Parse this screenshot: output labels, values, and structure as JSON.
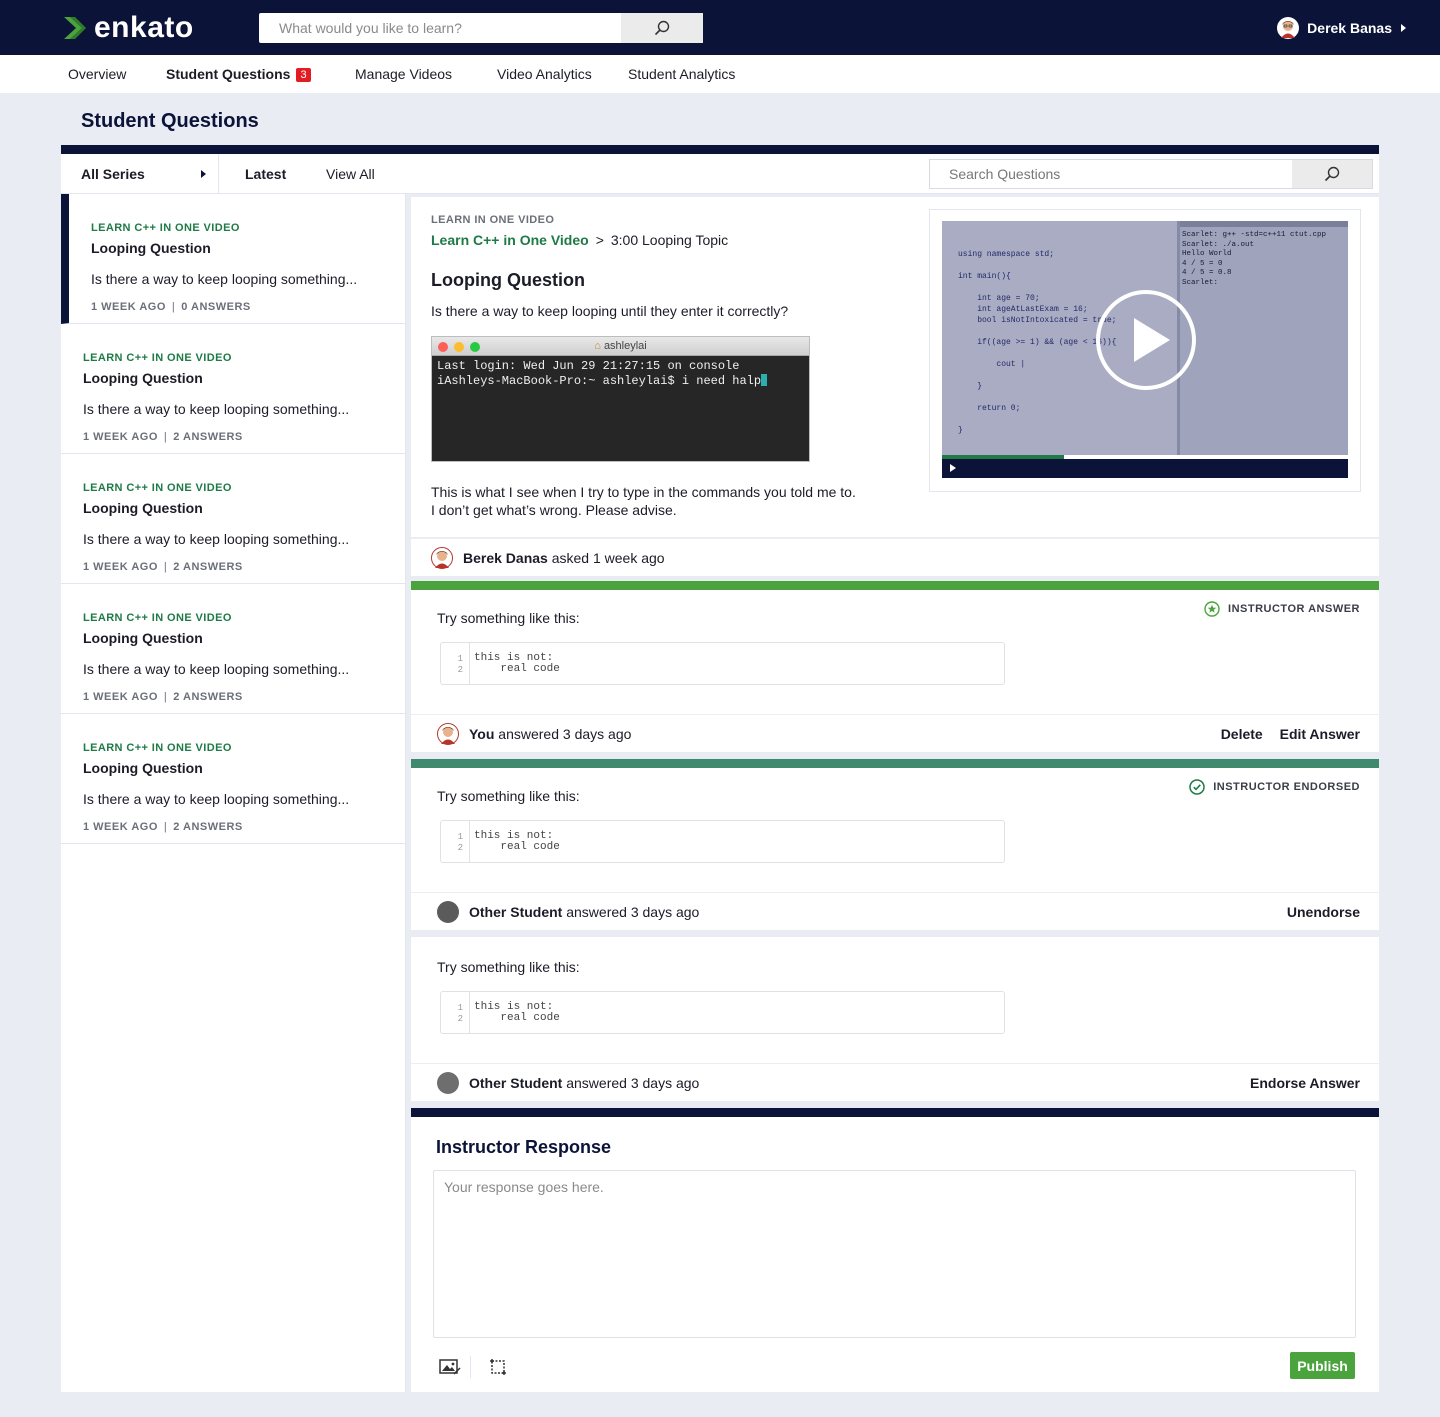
{
  "colors": {
    "navy": "#0c1338",
    "green": "#1e7a46",
    "badge_red": "#e31b23",
    "publish_green": "#4aa33c",
    "instructor_bar": "#4aa33c",
    "endorsed_bar": "#3f8a6e"
  },
  "header": {
    "brand": "enkato",
    "search_placeholder": "What would you like to learn?",
    "search_icon": "search-icon",
    "user_name": "Derek Banas"
  },
  "tabs": [
    {
      "label": "Overview"
    },
    {
      "label": "Student Questions",
      "badge": "3"
    },
    {
      "label": "Manage Videos"
    },
    {
      "label": "Video Analytics"
    },
    {
      "label": "Student Analytics"
    }
  ],
  "page": {
    "title": "Student Questions"
  },
  "filters": {
    "series": "All Series",
    "latest": "Latest",
    "view_all": "View All",
    "search_placeholder": "Search Questions"
  },
  "questions": [
    {
      "series": "LEARN C++ IN ONE VIDEO",
      "title": "Looping Question",
      "snippet": "Is there a way to keep looping something...",
      "age": "1 WEEK AGO",
      "answers": "0 ANSWERS"
    },
    {
      "series": "LEARN C++ IN ONE VIDEO",
      "title": "Looping Question",
      "snippet": "Is there a way to keep looping something...",
      "age": "1 WEEK AGO",
      "answers": "2 ANSWERS"
    },
    {
      "series": "LEARN C++ IN ONE VIDEO",
      "title": "Looping Question",
      "snippet": "Is there a way to keep looping something...",
      "age": "1 WEEK AGO",
      "answers": "2 ANSWERS"
    },
    {
      "series": "LEARN C++ IN ONE VIDEO",
      "title": "Looping Question",
      "snippet": "Is there a way to keep looping something...",
      "age": "1 WEEK AGO",
      "answers": "2 ANSWERS"
    },
    {
      "series": "LEARN C++ IN ONE VIDEO",
      "title": "Looping Question",
      "snippet": "Is there a way to keep looping something...",
      "age": "1 WEEK AGO",
      "answers": "2 ANSWERS"
    }
  ],
  "detail": {
    "series": "LEARN IN ONE VIDEO",
    "course_link": "Learn C++ in One Video",
    "crumb_sep": ">",
    "topic": "3:00 Looping Topic",
    "title": "Looping Question",
    "body": "Is there a way to keep looping until they enter it correctly?",
    "terminal": {
      "title": "ashleylai",
      "line1": "Last login: Wed Jun 29 21:27:15 on console",
      "line2": "iAshleys-MacBook-Pro:~ ashleylai$ i need halp"
    },
    "body2_line1": "This is what I see when I try to type in the commands you told me to.",
    "body2_line2": "I don’t get what’s wrong. Please advise.",
    "video": {
      "code": "using namespace std;\n\nint main(){\n\n    int age = 70;\n    int ageAtLastExam = 16;\n    bool isNotIntoxicated = true;\n\n    if((age >= 1) && (age < 16)){\n\n        cout |\n\n    }\n\n    return 0;\n\n}",
      "console": "Scarlet: g++ -std=c++11 ctut.cpp\nScarlet: ./a.out\nHello World\n4 / 5 = 0\n4 / 5 = 0.8\nScarlet:",
      "progress": 0.3
    },
    "asker_name": "Berek Danas",
    "asked_text": "asked 1 week ago"
  },
  "answers": [
    {
      "intro": "Try something like this:",
      "tag": "INSTRUCTOR ANSWER",
      "code_lines": [
        "1",
        "2"
      ],
      "code": "this is not:\n    real code",
      "author": "You",
      "when": "answered 3 days ago",
      "actions": [
        "Delete",
        "Edit Answer"
      ]
    },
    {
      "intro": "Try something like this:",
      "tag": "INSTRUCTOR ENDORSED",
      "code_lines": [
        "1",
        "2"
      ],
      "code": "this is not:\n    real code",
      "author": "Other Student",
      "when": "answered 3 days ago",
      "actions": [
        "Unendorse"
      ]
    },
    {
      "intro": "Try something like this:",
      "code_lines": [
        "1",
        "2"
      ],
      "code": "this is not:\n    real code",
      "author": "Other Student",
      "when": "answered 3 days ago",
      "actions": [
        "Endorse Answer"
      ]
    }
  ],
  "response": {
    "title": "Instructor Response",
    "placeholder": "Your response goes here.",
    "publish": "Publish"
  }
}
